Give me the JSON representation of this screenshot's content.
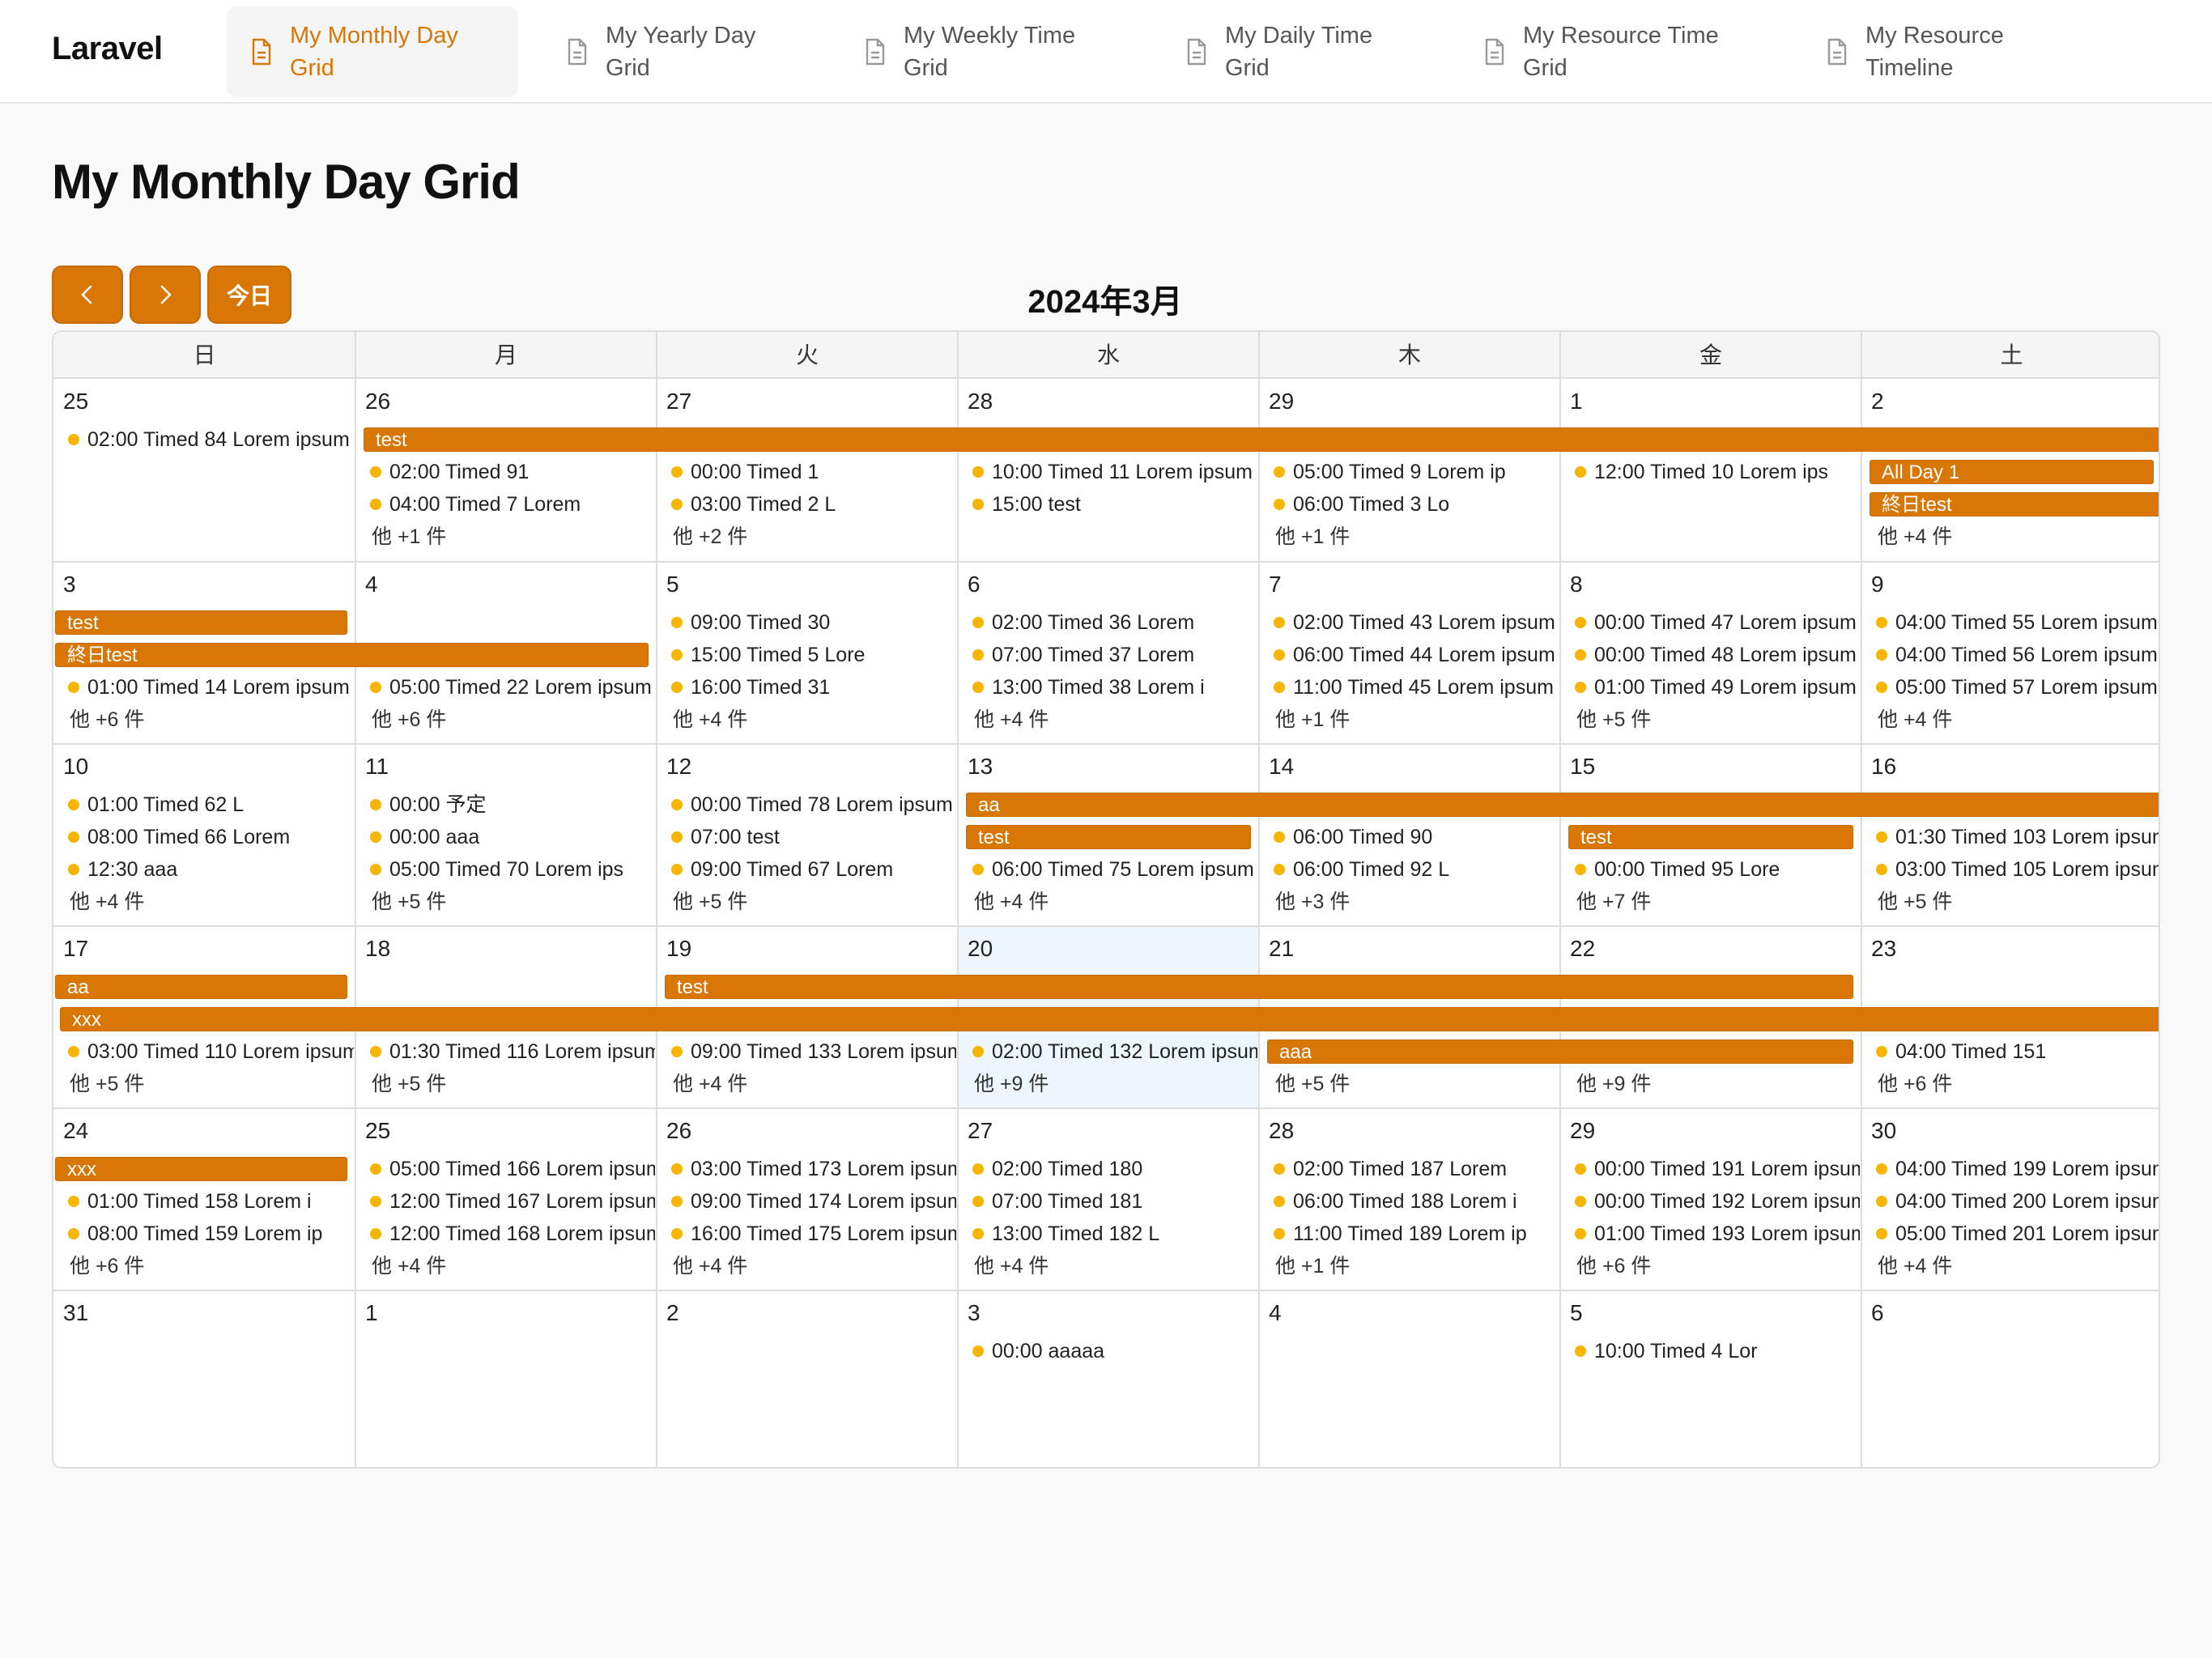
{
  "nav": {
    "brand": "Laravel",
    "items": [
      {
        "label": "My Monthly Day\nGrid"
      },
      {
        "label": "My Yearly Day\nGrid"
      },
      {
        "label": "My Weekly Time\nGrid"
      },
      {
        "label": "My Daily Time\nGrid"
      },
      {
        "label": "My Resource Time\nGrid"
      },
      {
        "label": "My Resource\nTimeline"
      }
    ]
  },
  "page": {
    "title": "My Monthly Day Grid"
  },
  "toolbar": {
    "prev_icon": "chevron-left-icon",
    "next_icon": "chevron-right-icon",
    "today_label": "今日",
    "title": "2024年3月"
  },
  "calendar": {
    "weekdays": [
      "日",
      "月",
      "火",
      "水",
      "木",
      "金",
      "土"
    ],
    "today": "2024-03-20",
    "colors": {
      "accent": "#d97706",
      "dot": "#f7b500",
      "today_bg": "#eef6fd"
    },
    "weeks": [
      {
        "days": [
          {
            "num": "25",
            "events": [
              "02:00 Timed 84 Lorem ipsum"
            ],
            "more": ""
          },
          {
            "num": "26",
            "events": [
              "02:00 Timed 91",
              "04:00 Timed 7 Lorem"
            ],
            "more": "他 +1 件"
          },
          {
            "num": "27",
            "events": [
              "00:00 Timed 1",
              "03:00 Timed 2 L"
            ],
            "more": "他 +2 件"
          },
          {
            "num": "28",
            "events": [
              "10:00 Timed 11 Lorem ipsum",
              "15:00 test"
            ],
            "more": ""
          },
          {
            "num": "29",
            "events": [
              "05:00 Timed 9 Lorem ip",
              "06:00 Timed 3 Lo"
            ],
            "more": "他 +1 件"
          },
          {
            "num": "1",
            "events": [
              "12:00 Timed 10 Lorem ips"
            ],
            "more": ""
          },
          {
            "num": "2",
            "events": [],
            "more": "他 +4 件"
          }
        ],
        "bars": [
          {
            "label": "test"
          },
          {
            "label": "All Day 1"
          },
          {
            "label": "終日test"
          }
        ]
      },
      {
        "days": [
          {
            "num": "3",
            "events": [
              "01:00 Timed 14 Lorem ipsum"
            ],
            "more": "他 +6 件"
          },
          {
            "num": "4",
            "events": [
              "05:00 Timed 22 Lorem ipsum"
            ],
            "more": "他 +6 件"
          },
          {
            "num": "5",
            "events": [
              "09:00 Timed 30",
              "15:00 Timed 5 Lore",
              "16:00 Timed 31"
            ],
            "more": "他 +4 件"
          },
          {
            "num": "6",
            "events": [
              "02:00 Timed 36 Lorem",
              "07:00 Timed 37 Lorem",
              "13:00 Timed 38 Lorem i"
            ],
            "more": "他 +4 件"
          },
          {
            "num": "7",
            "events": [
              "02:00 Timed 43 Lorem ipsum",
              "06:00 Timed 44 Lorem ipsum",
              "11:00 Timed 45 Lorem ipsum"
            ],
            "more": "他 +1 件"
          },
          {
            "num": "8",
            "events": [
              "00:00 Timed 47 Lorem ipsum",
              "00:00 Timed 48 Lorem ipsum",
              "01:00 Timed 49 Lorem ipsum"
            ],
            "more": "他 +5 件"
          },
          {
            "num": "9",
            "events": [
              "04:00 Timed 55 Lorem ipsum",
              "04:00 Timed 56 Lorem ipsum",
              "05:00 Timed 57 Lorem ipsum"
            ],
            "more": "他 +4 件"
          }
        ],
        "bars": [
          {
            "label": "test"
          },
          {
            "label": "終日test"
          }
        ]
      },
      {
        "days": [
          {
            "num": "10",
            "events": [
              "01:00 Timed 62 L",
              "08:00 Timed 66 Lorem",
              "12:30 aaa"
            ],
            "more": "他 +4 件"
          },
          {
            "num": "11",
            "events": [
              "00:00 予定",
              "00:00 aaa",
              "05:00 Timed 70 Lorem ips"
            ],
            "more": "他 +5 件"
          },
          {
            "num": "12",
            "events": [
              "00:00 Timed 78 Lorem ipsum",
              "07:00 test",
              "09:00 Timed 67 Lorem"
            ],
            "more": "他 +5 件"
          },
          {
            "num": "13",
            "events": [
              "06:00 Timed 75 Lorem ipsum"
            ],
            "more": "他 +4 件"
          },
          {
            "num": "14",
            "events": [
              "06:00 Timed 90",
              "06:00 Timed 92 L"
            ],
            "more": "他 +3 件"
          },
          {
            "num": "15",
            "events": [
              "00:00 Timed 95 Lore"
            ],
            "more": "他 +7 件"
          },
          {
            "num": "16",
            "events": [
              "01:30 Timed 103 Lorem ipsum",
              "03:00 Timed 105 Lorem ipsum"
            ],
            "more": "他 +5 件"
          }
        ],
        "bars": [
          {
            "label": "aa"
          },
          {
            "label": "test"
          },
          {
            "label": "test"
          }
        ]
      },
      {
        "days": [
          {
            "num": "17",
            "events": [
              "03:00 Timed 110 Lorem ipsum"
            ],
            "more": "他 +5 件"
          },
          {
            "num": "18",
            "events": [
              "01:30 Timed 116 Lorem ipsum"
            ],
            "more": "他 +5 件"
          },
          {
            "num": "19",
            "events": [
              "09:00 Timed 133 Lorem ipsum"
            ],
            "more": "他 +4 件"
          },
          {
            "num": "20",
            "events": [
              "02:00 Timed 132 Lorem ipsum"
            ],
            "more": "他 +9 件"
          },
          {
            "num": "21",
            "events": [],
            "more": "他 +5 件"
          },
          {
            "num": "22",
            "events": [],
            "more": "他 +9 件"
          },
          {
            "num": "23",
            "events": [
              "04:00 Timed 151"
            ],
            "more": "他 +6 件"
          }
        ],
        "bars": [
          {
            "label": "aa"
          },
          {
            "label": "test"
          },
          {
            "label": "xxx"
          },
          {
            "label": "aaa"
          }
        ]
      },
      {
        "days": [
          {
            "num": "24",
            "events": [
              "01:00 Timed 158 Lorem i",
              "08:00 Timed 159 Lorem ip"
            ],
            "more": "他 +6 件"
          },
          {
            "num": "25",
            "events": [
              "05:00 Timed 166 Lorem ipsum",
              "12:00 Timed 167 Lorem ipsum",
              "12:00 Timed 168 Lorem ipsum"
            ],
            "more": "他 +4 件"
          },
          {
            "num": "26",
            "events": [
              "03:00 Timed 173 Lorem ipsum",
              "09:00 Timed 174 Lorem ipsum",
              "16:00 Timed 175 Lorem ipsum"
            ],
            "more": "他 +4 件"
          },
          {
            "num": "27",
            "events": [
              "02:00 Timed 180",
              "07:00 Timed 181",
              "13:00 Timed 182 L"
            ],
            "more": "他 +4 件"
          },
          {
            "num": "28",
            "events": [
              "02:00 Timed 187 Lorem",
              "06:00 Timed 188 Lorem i",
              "11:00 Timed 189 Lorem ip"
            ],
            "more": "他 +1 件"
          },
          {
            "num": "29",
            "events": [
              "00:00 Timed 191 Lorem ipsum",
              "00:00 Timed 192 Lorem ipsum",
              "01:00 Timed 193 Lorem ipsum"
            ],
            "more": "他 +6 件"
          },
          {
            "num": "30",
            "events": [
              "04:00 Timed 199 Lorem ipsum",
              "04:00 Timed 200 Lorem ipsum",
              "05:00 Timed 201 Lorem ipsum"
            ],
            "more": "他 +4 件"
          }
        ],
        "bars": [
          {
            "label": "xxx"
          }
        ]
      },
      {
        "days": [
          {
            "num": "31",
            "events": [],
            "more": ""
          },
          {
            "num": "1",
            "events": [],
            "more": ""
          },
          {
            "num": "2",
            "events": [],
            "more": ""
          },
          {
            "num": "3",
            "events": [
              "00:00 aaaaa"
            ],
            "more": ""
          },
          {
            "num": "4",
            "events": [],
            "more": ""
          },
          {
            "num": "5",
            "events": [
              "10:00 Timed 4 Lor"
            ],
            "more": ""
          },
          {
            "num": "6",
            "events": [],
            "more": ""
          }
        ],
        "bars": []
      }
    ]
  }
}
